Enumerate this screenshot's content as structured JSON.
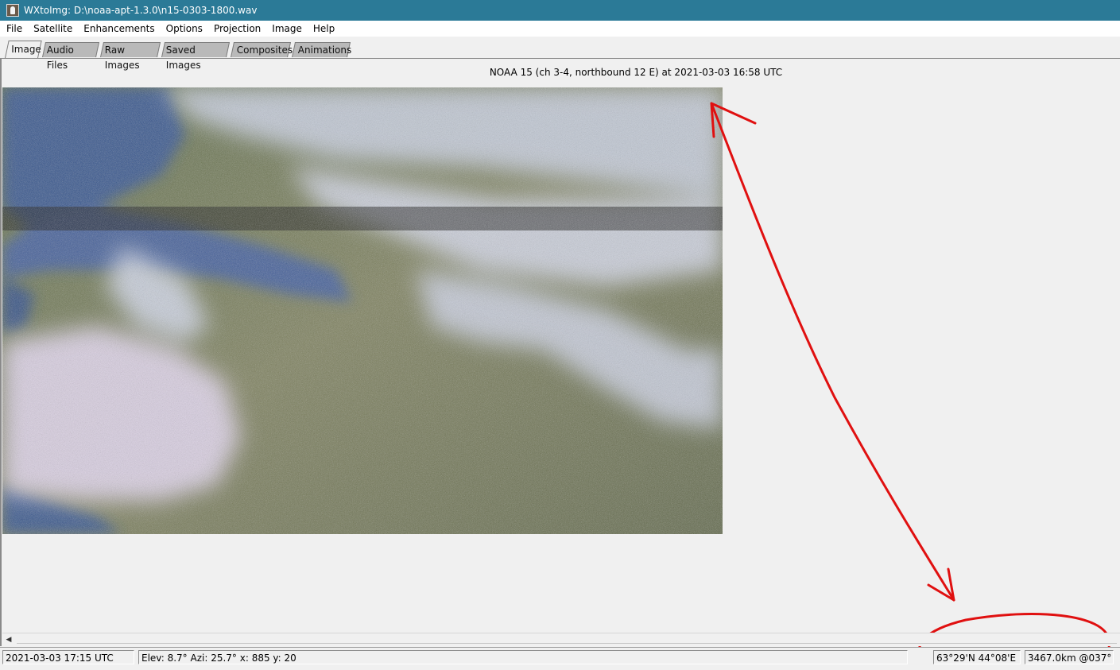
{
  "window": {
    "title": "WXtoImg: D:\\noaa-apt-1.3.0\\n15-0303-1800.wav",
    "icon": "wxtoimg-app-icon"
  },
  "menu": [
    "File",
    "Satellite",
    "Enhancements",
    "Options",
    "Projection",
    "Image",
    "Help"
  ],
  "tabs": [
    {
      "label": "Image",
      "active": true
    },
    {
      "label": "Audio Files",
      "active": false
    },
    {
      "label": "Raw Images",
      "active": false
    },
    {
      "label": "Saved Images",
      "active": false
    },
    {
      "label": "Composites",
      "active": false
    },
    {
      "label": "Animations",
      "active": false
    }
  ],
  "image": {
    "caption": "NOAA 15 (ch 3-4, northbound 12 E) at 2021-03-03  16:58 UTC"
  },
  "scrollbar": {
    "left_arrow": "◀"
  },
  "status": {
    "time": "2021-03-03  17:15 UTC",
    "position": "Elev: 8.7°  Azi: 25.7°  x: 885  y: 20",
    "coords": "63°29'N 44°08'E",
    "distance": "3467.0km @037°"
  },
  "colors": {
    "titlebar": "#2b7a97",
    "annotation": "#e01010"
  }
}
